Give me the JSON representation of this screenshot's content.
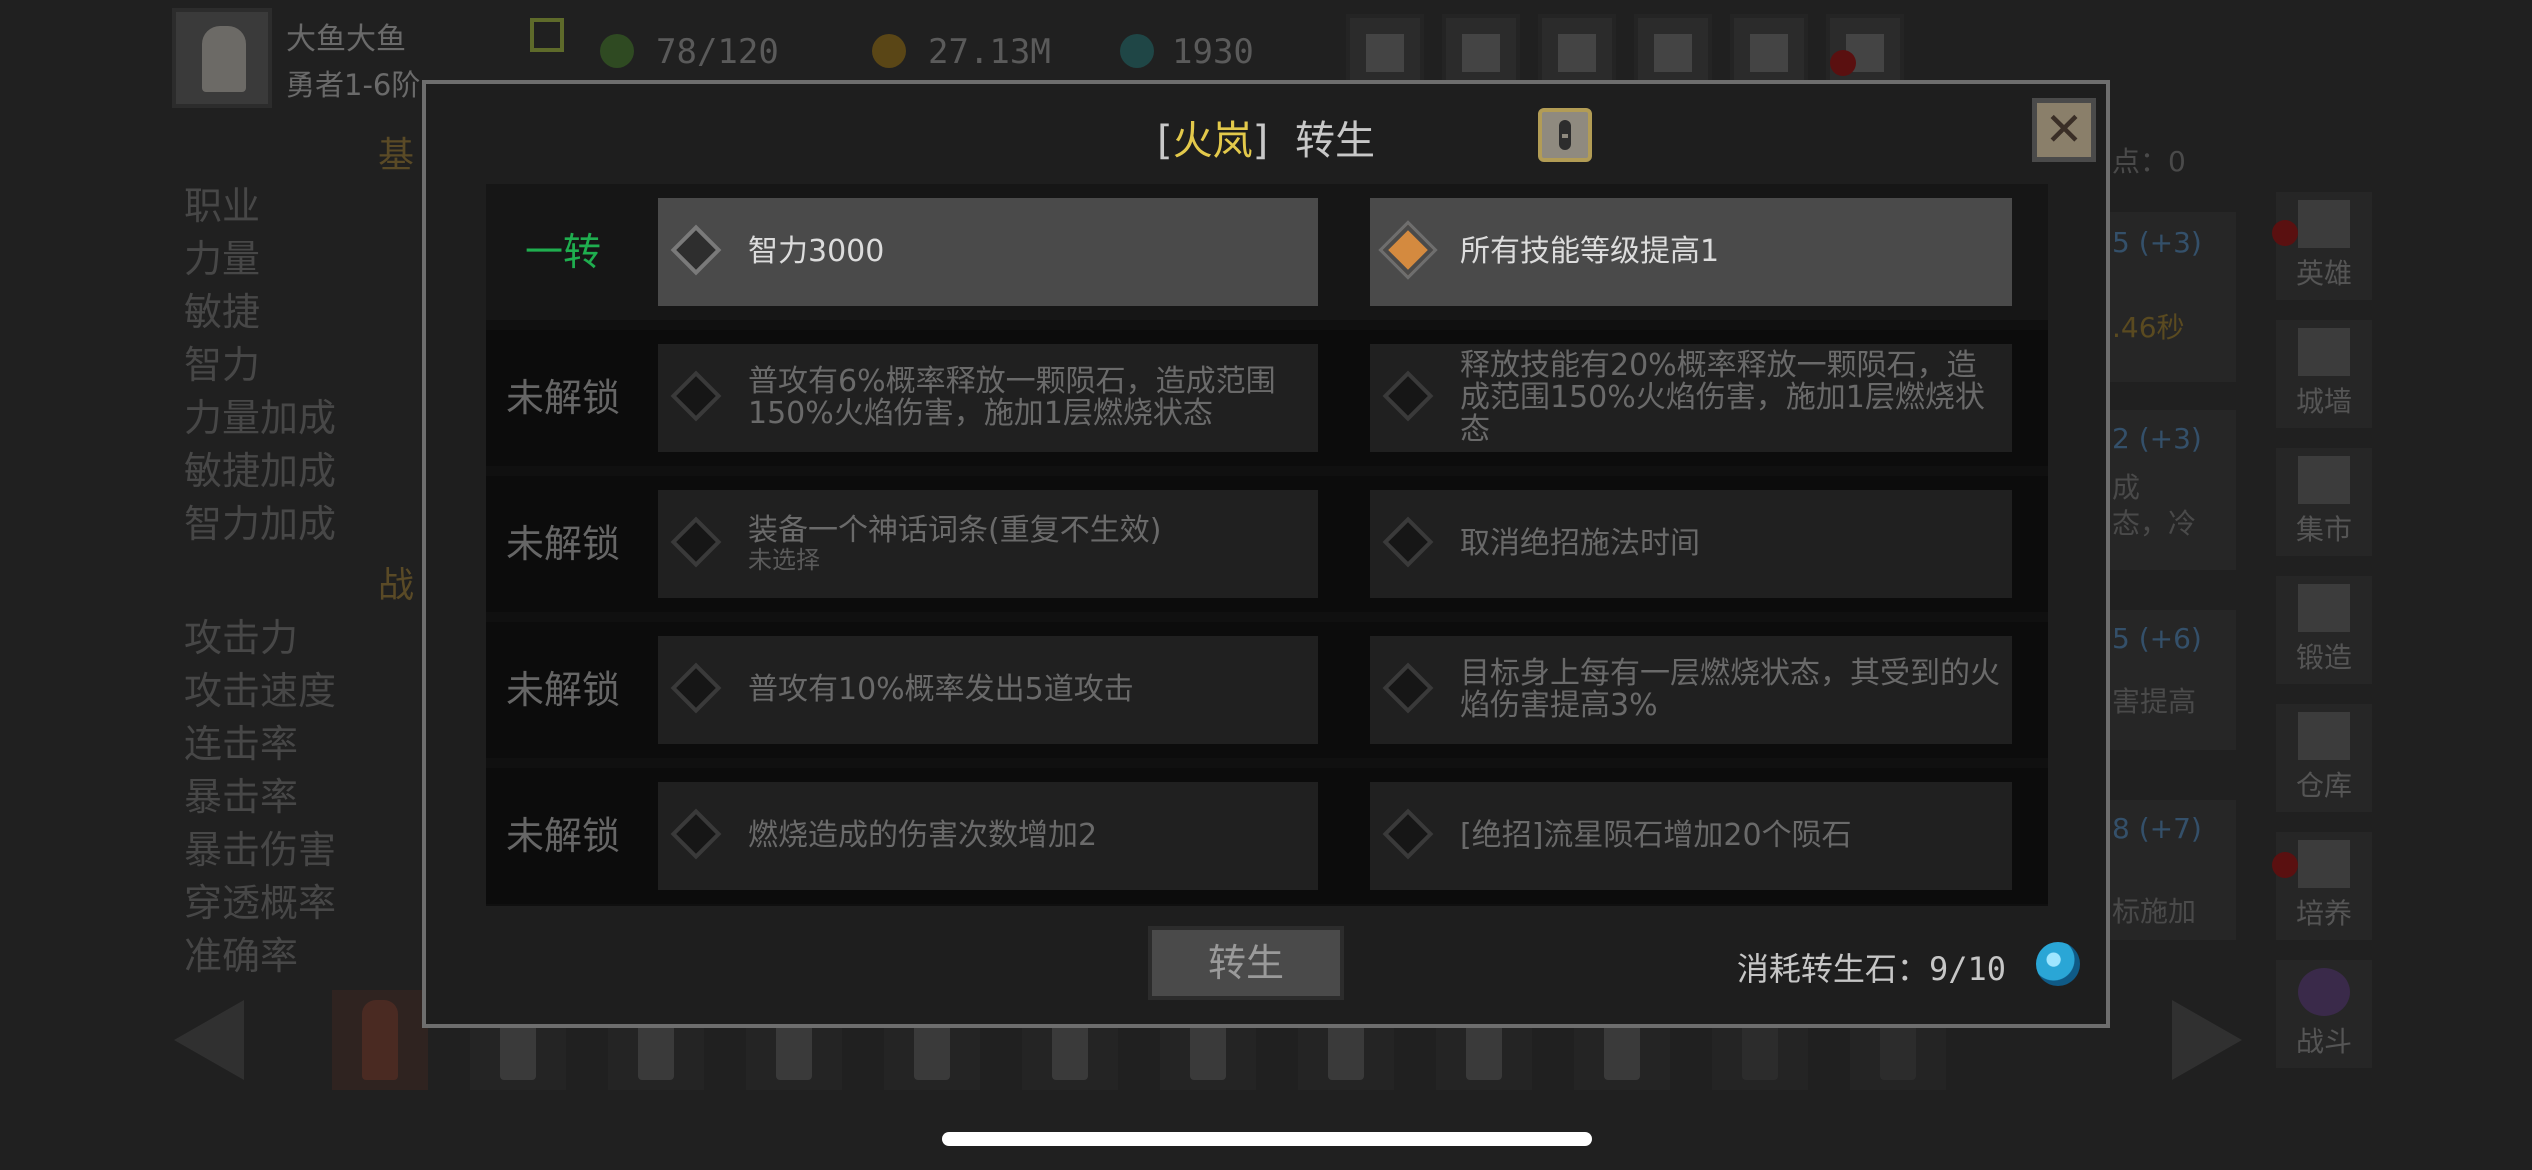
{
  "player": {
    "name": "大鱼大鱼",
    "rank": "勇者1-6阶"
  },
  "resources": [
    {
      "name": "stamina",
      "value": "78/120",
      "color": "#3f6a2a"
    },
    {
      "name": "gold",
      "value": "27.13M",
      "color": "#8a6a1a"
    },
    {
      "name": "gems",
      "value": "1930",
      "color": "#2a6a6a"
    }
  ],
  "top_buttons": [
    "cart-icon",
    "mail-icon",
    "gamepad-icon",
    "gear-icon",
    "wheel-icon",
    "bird-icon"
  ],
  "left_panel": {
    "section1_heading": "基",
    "section2_heading": "战",
    "stats1": [
      "职业",
      "力量",
      "敏捷",
      "智力",
      "力量加成",
      "敏捷加成",
      "智力加成"
    ],
    "stats2": [
      "攻击力",
      "攻击速度",
      "连击率",
      "暴击率",
      "暴击伤害",
      "穿透概率",
      "准确率"
    ]
  },
  "right_peek": {
    "points_label": "点：0",
    "lines": [
      "5 (+3)",
      ".46秒",
      "2 (+3)",
      "成",
      "态，冷",
      "5 (+6)",
      "害提高",
      "8 (+7)",
      "标施加"
    ]
  },
  "side_nav": [
    "英雄",
    "城墙",
    "集市",
    "锻造",
    "仓库",
    "培养",
    "战斗"
  ],
  "modal": {
    "title_open": "[",
    "title_name": "火岚",
    "title_close": "]",
    "title_action": "转生",
    "rows": [
      {
        "label": "一转",
        "active": true,
        "left": {
          "text": "智力3000",
          "sub": ""
        },
        "right": {
          "text": "所有技能等级提高1",
          "sub": ""
        }
      },
      {
        "label": "未解锁",
        "active": false,
        "left": {
          "text": "普攻有6%概率释放一颗陨石，造成范围150%火焰伤害，施加1层燃烧状态",
          "sub": ""
        },
        "right": {
          "text": "释放技能有20%概率释放一颗陨石，造成范围150%火焰伤害，施加1层燃烧状态",
          "sub": ""
        }
      },
      {
        "label": "未解锁",
        "active": false,
        "left": {
          "text": "装备一个神话词条(重复不生效)",
          "sub": "未选择"
        },
        "right": {
          "text": "取消绝招施法时间",
          "sub": ""
        }
      },
      {
        "label": "未解锁",
        "active": false,
        "left": {
          "text": "普攻有10%概率发出5道攻击",
          "sub": ""
        },
        "right": {
          "text": "目标身上每有一层燃烧状态，其受到的火焰伤害提高3%",
          "sub": ""
        }
      },
      {
        "label": "未解锁",
        "active": false,
        "left": {
          "text": "燃烧造成的伤害次数增加2",
          "sub": ""
        },
        "right": {
          "text": "[绝招]流星陨石增加20个陨石",
          "sub": ""
        }
      }
    ],
    "rebirth_button": "转生",
    "cost_label": "消耗转生石：",
    "cost_value": "9/10"
  }
}
